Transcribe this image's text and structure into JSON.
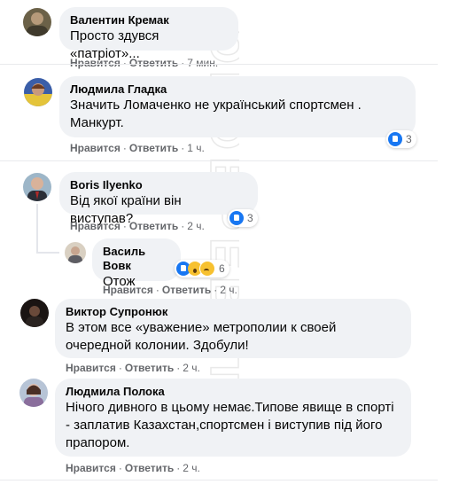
{
  "actions": {
    "like": "Нравится",
    "reply": "Ответить",
    "dot": "·"
  },
  "watermark": "ODOBPEBAT",
  "comments": [
    {
      "author": "Валентин Кремак",
      "text": "Просто здувся «патріот»...",
      "time": "7 мин."
    },
    {
      "author": "Людмила Гладка",
      "text": "Значить Ломаченко не український спортсмен .\nМанкурт.",
      "time": "1 ч.",
      "reactions": "3"
    },
    {
      "author": "Boris Ilyenko",
      "text": "Від якої країни він виступав?",
      "time": "2 ч.",
      "reactions": "3"
    },
    {
      "author": "Василь Вовк",
      "text": "Отож",
      "time": "2 ч.",
      "reactions": "6"
    },
    {
      "author": "Виктор Супронюк",
      "text": "В этом все «уважение» метрополии к своей\nочередной колонии. Здобули!",
      "time": "2 ч."
    },
    {
      "author": "Людмила Полока",
      "text": "Нічого дивного в цьому немає.Типове явище в спорті\n- заплатив Казахстан,спортсмен і виступив під його\nпрапором.",
      "time": "2 ч."
    }
  ],
  "colors": {
    "bubble": "#f0f2f5",
    "meta": "#65676b",
    "like": "#1877f2",
    "wow": "#f7c130"
  }
}
